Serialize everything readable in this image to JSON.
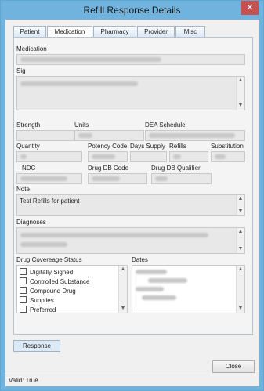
{
  "window": {
    "title": "Refill Response Details",
    "close_glyph": "✕"
  },
  "tabs": [
    {
      "label": "Patient"
    },
    {
      "label": "Medication"
    },
    {
      "label": "Pharmacy"
    },
    {
      "label": "Provider"
    },
    {
      "label": "Misc"
    }
  ],
  "labels": {
    "medication": "Medication",
    "sig": "Sig",
    "strength": "Strength",
    "units": "Units",
    "dea_schedule": "DEA Schedule",
    "quantity": "Quantity",
    "potency_code": "Potency Code",
    "days_supply": "Days Supply",
    "refills": "Refills",
    "substitution": "Substitution",
    "ndc": "NDC",
    "drug_db_code": "Drug DB Code",
    "drug_db_qualifier": "Drug DB Qualifier",
    "note": "Note",
    "diagnoses": "Diagnoses",
    "drug_coverage_status": "Drug Covereage Status",
    "dates": "Dates"
  },
  "note_text": "Test Refills for patient",
  "coverage_items": [
    {
      "label": "Digitally Signed"
    },
    {
      "label": "Controlled Substance"
    },
    {
      "label": "Compound Drug"
    },
    {
      "label": "Supplies"
    },
    {
      "label": "Preferred"
    }
  ],
  "bottom_tab": "Response",
  "buttons": {
    "close": "Close"
  },
  "status": "Valid: True",
  "scroll_up": "▲",
  "scroll_down": "▼"
}
